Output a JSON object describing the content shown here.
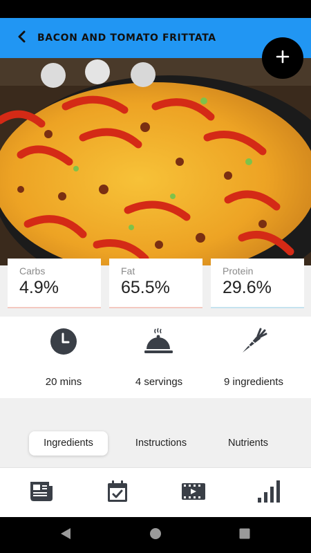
{
  "app_bar": {
    "title": "BACON AND TOMATO FRITTATA",
    "color": "#2196f3"
  },
  "icons": {
    "back": "arrow-back-icon",
    "add": "plus-icon",
    "time": "clock-icon",
    "servings": "cloche-icon",
    "ingredients": "carrot-icon"
  },
  "macros": [
    {
      "label": "Carbs",
      "value": "4.9%"
    },
    {
      "label": "Fat",
      "value": "65.5%"
    },
    {
      "label": "Protein",
      "value": "29.6%"
    }
  ],
  "stats": [
    {
      "text": "20 mins"
    },
    {
      "text": "4 servings"
    },
    {
      "text": "9 ingredients"
    }
  ],
  "tabs": [
    {
      "label": "Ingredients",
      "active": true
    },
    {
      "label": "Instructions",
      "active": false
    },
    {
      "label": "Nutrients",
      "active": false
    }
  ],
  "bottom_nav": [
    "newspaper-icon",
    "calendar-check-icon",
    "video-icon",
    "bar-chart-icon"
  ]
}
